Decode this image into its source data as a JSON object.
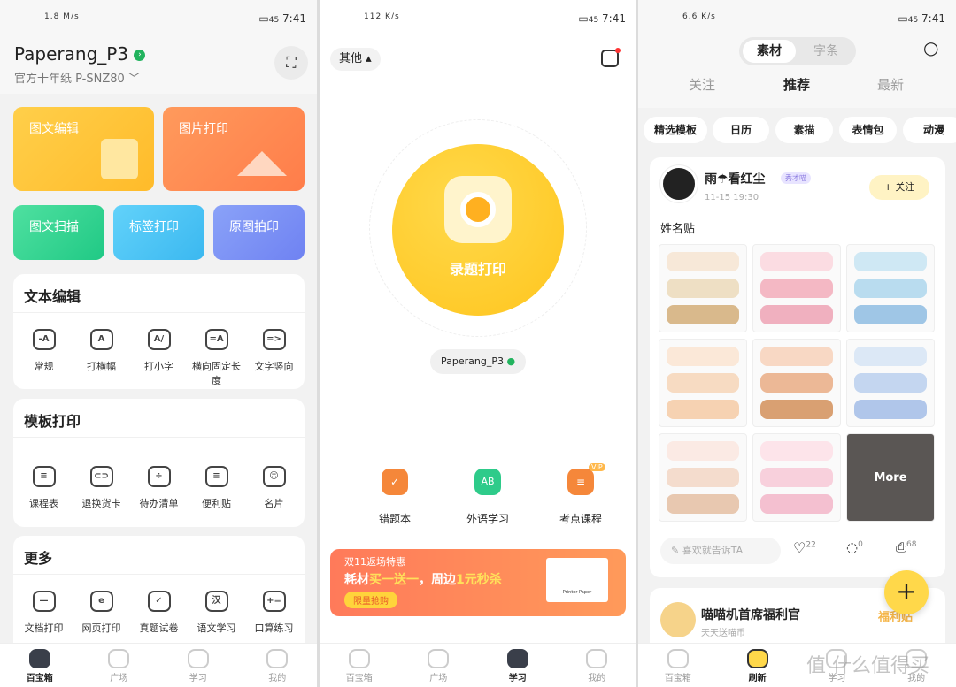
{
  "status": [
    {
      "speed": "1.8 M/s",
      "time": "7:41",
      "battery": "45"
    },
    {
      "speed": "112 K/s",
      "time": "7:41",
      "battery": "45"
    },
    {
      "speed": "6.6 K/s",
      "time": "7:41",
      "battery": "45"
    }
  ],
  "p1": {
    "device": "Paperang_P3",
    "paper": "官方十年纸 P-SNZ80 ﹀",
    "cards": [
      "图文编辑",
      "图片打印",
      "图文扫描",
      "标签打印",
      "原图拍印"
    ],
    "sections": [
      {
        "title": "文本编辑",
        "items": [
          "常规",
          "打横幅",
          "打小字",
          "横向固定长度",
          "文字竖向"
        ],
        "icons": [
          "-A",
          "A",
          "A/",
          "=A",
          "=>"
        ]
      },
      {
        "title": "模板打印",
        "items": [
          "课程表",
          "退换货卡",
          "待办清单",
          "便利贴",
          "名片"
        ],
        "icons": [
          "≡",
          "⊂⊃",
          "÷",
          "≡",
          "☺"
        ]
      },
      {
        "title": "更多",
        "items": [
          "文档打印",
          "网页打印",
          "真题试卷",
          "语文学习",
          "口算练习"
        ],
        "icons": [
          "—",
          "e",
          "✓",
          "汉",
          "+="
        ]
      }
    ],
    "tabs": [
      "百宝箱",
      "广场",
      "学习",
      "我的"
    ]
  },
  "p2": {
    "filter": "其他 ▴",
    "main_button": "录题打印",
    "device_chip": "Paperang_P3",
    "tools": [
      {
        "label": "错题本",
        "icon": "✓",
        "color": "#f5873a"
      },
      {
        "label": "外语学习",
        "icon": "AB",
        "color": "#2ecb8a"
      },
      {
        "label": "考点课程",
        "icon": "≡",
        "color": "#f5873a",
        "badge": "VIP"
      }
    ],
    "banner": {
      "line1": "双11返场特惠",
      "line2a": "耗材",
      "line2b": "买一送一",
      "line2c": "，周边",
      "line2d": "1元秒杀",
      "cta": "限量抢购",
      "product": "Printer Paper"
    },
    "tabs": [
      "百宝箱",
      "广场",
      "学习",
      "我的"
    ]
  },
  "p3": {
    "seg": [
      "素材",
      "字条"
    ],
    "feeds": [
      "关注",
      "推荐",
      "最新"
    ],
    "chips": [
      "精选模板",
      "日历",
      "素描",
      "表情包",
      "动漫"
    ],
    "post": {
      "user": "雨☂看红尘",
      "badge": "秀才喵",
      "time": "11-15 19:30",
      "follow": "+ 关注",
      "title": "姓名贴",
      "more": "More",
      "comment_placeholder": "喜欢就告诉TA",
      "likes": "22",
      "comments": "0",
      "prints": "68"
    },
    "post2": {
      "user": "喵喵机首席福利官",
      "sub": "天天送喵币",
      "tag": "福利贴"
    },
    "fab": "+",
    "tabs": [
      "百宝箱",
      "刷新",
      "学习",
      "我的"
    ],
    "watermark": "值 什么值得买"
  },
  "colors": {
    "yellow": "#ffd43b",
    "orange": "#ff8a50",
    "green": "#2fd28a",
    "blue": "#4dc6f5",
    "purple": "#7b8cf5",
    "accent": "#ffd84a"
  }
}
